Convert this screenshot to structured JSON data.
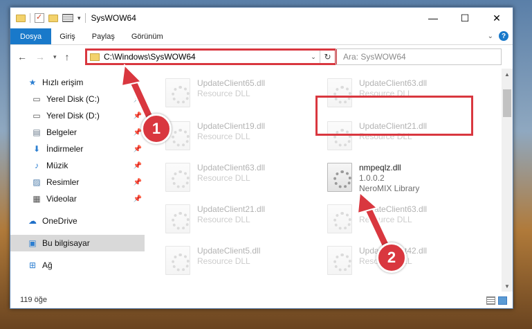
{
  "window": {
    "title": "SysWOW64",
    "controls": {
      "minimize": "—",
      "maximize": "☐",
      "close": "✕"
    }
  },
  "ribbon": {
    "tabs": [
      "Dosya",
      "Giriş",
      "Paylaş",
      "Görünüm"
    ]
  },
  "address": {
    "path": "C:\\Windows\\SysWOW64",
    "search_placeholder": "Ara: SysWOW64"
  },
  "sidebar": {
    "quick_access": "Hızlı erişim",
    "items": [
      {
        "label": "Yerel Disk (C:)",
        "icon": "drive-icon"
      },
      {
        "label": "Yerel Disk (D:)",
        "icon": "drive-icon"
      },
      {
        "label": "Belgeler",
        "icon": "documents-icon"
      },
      {
        "label": "İndirmeler",
        "icon": "download-icon"
      },
      {
        "label": "Müzik",
        "icon": "music-icon"
      },
      {
        "label": "Resimler",
        "icon": "pictures-icon"
      },
      {
        "label": "Videolar",
        "icon": "videos-icon"
      }
    ],
    "onedrive": "OneDrive",
    "this_pc": "Bu bilgisayar",
    "network": "Ağ"
  },
  "files": [
    {
      "name": "UpdateClient65.dll",
      "desc": "Resource DLL"
    },
    {
      "name": "UpdateClient63.dll",
      "desc": "Resource DLL"
    },
    {
      "name": "UpdateClient19.dll",
      "desc": "Resource DLL"
    },
    {
      "name": "UpdateClient21.dll",
      "desc": "Resource DLL"
    },
    {
      "name": "UpdateClient63.dll",
      "desc": "Resource DLL"
    },
    {
      "name": "nmpeqlz.dll",
      "version": "1.0.0.2",
      "desc": "NeroMIX Library"
    },
    {
      "name": "UpdateClient21.dll",
      "desc": "Resource DLL"
    },
    {
      "name": "UpdateClient63.dll",
      "desc": "Resource DLL"
    },
    {
      "name": "UpdateClient5.dll",
      "desc": "Resource DLL"
    },
    {
      "name": "UpdateClient42.dll",
      "desc": "Resource DLL"
    }
  ],
  "status": {
    "count": "119 öğe"
  },
  "annotations": {
    "step1": "1",
    "step2": "2",
    "accent": "#d9373f"
  }
}
